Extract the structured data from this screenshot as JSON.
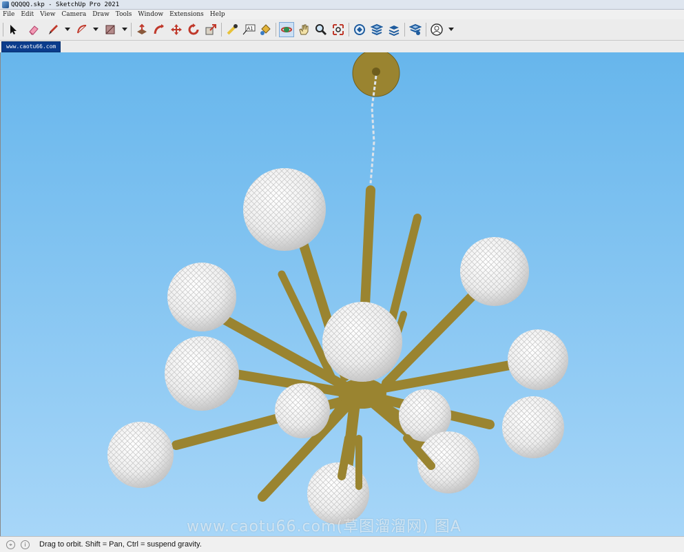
{
  "window": {
    "title": "QQQQQ.skp - SketchUp Pro 2021"
  },
  "menu": [
    "File",
    "Edit",
    "View",
    "Camera",
    "Draw",
    "Tools",
    "Window",
    "Extensions",
    "Help"
  ],
  "toolbar": {
    "tools": [
      "select-tool",
      "eraser-tool",
      "pencil-line-tool",
      "arc-tool",
      "rectangle-tool",
      "push-pull-tool",
      "follow-me-tool",
      "move-tool",
      "rotate-tool",
      "scale-tool",
      "tape-measure-tool",
      "text-tool",
      "paint-bucket-tool",
      "orbit-tool",
      "pan-tool",
      "zoom-tool",
      "zoom-extents-tool",
      "warehouse-tool",
      "extension-warehouse-tool",
      "layout-tool",
      "extension-manager-tool",
      "account-tool"
    ],
    "active_tool": "orbit-tool",
    "text_tool_label": "A1"
  },
  "scene_tab": {
    "label": "www.caotu66.com"
  },
  "viewport": {
    "sky_top": "#67b6ec",
    "sky_bottom": "#a7d6f8",
    "brass_color": "#9a8430",
    "watermark": "www.caotu66.com(草图溜溜网) 图A"
  },
  "status": {
    "message": "Drag to orbit. Shift = Pan, Ctrl = suspend gravity."
  }
}
